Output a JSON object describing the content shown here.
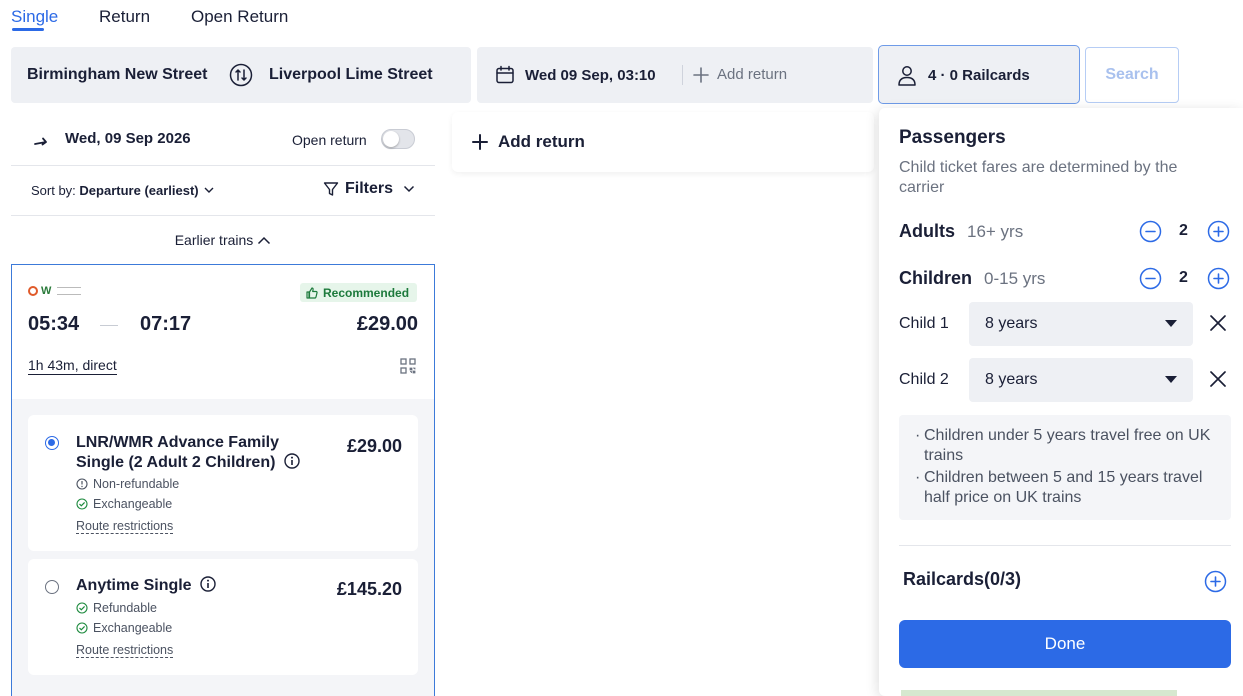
{
  "tabs": {
    "single": "Single",
    "return": "Return",
    "open_return": "Open Return"
  },
  "search": {
    "from": "Birmingham New Street",
    "to": "Liverpool Lime Street",
    "date": "Wed 09 Sep, 03:10",
    "add_return": "Add return",
    "passengers": "4 · 0 Railcards",
    "search_button": "Search"
  },
  "results": {
    "date": "Wed, 09 Sep 2026",
    "open_return_label": "Open return",
    "open_return_on": false,
    "sort_prefix": "Sort by:",
    "sort_value": "Departure (earliest)",
    "filters": "Filters",
    "earlier_trains": "Earlier trains",
    "journey": {
      "badge": "Recommended",
      "depart": "05:34",
      "arrive": "07:17",
      "price": "£29.00",
      "duration": "1h 43m, direct"
    },
    "fares": [
      {
        "name": "LNR/WMR Advance Family Single (2 Adult 2 Children)",
        "price": "£29.00",
        "selected": true,
        "line1": "Non-refundable",
        "line2": "Exchangeable",
        "restrictions": "Route restrictions"
      },
      {
        "name": "Anytime Single",
        "price": "£145.20",
        "selected": false,
        "line1": "Refundable",
        "line2": "Exchangeable",
        "restrictions": "Route restrictions"
      }
    ]
  },
  "middle": {
    "add_return": "Add return"
  },
  "passengers_panel": {
    "title": "Passengers",
    "subtitle": "Child ticket fares are determined by the carrier",
    "adults_label": "Adults",
    "adults_age": "16+ yrs",
    "adults_count": "2",
    "children_label": "Children",
    "children_age": "0-15 yrs",
    "children_count": "2",
    "child1_label": "Child 1",
    "child1_value": "8 years",
    "child2_label": "Child 2",
    "child2_value": "8 years",
    "note1": "Children under 5 years travel free on UK trains",
    "note2": "Children between 5 and 15 years travel half price on UK trains",
    "railcards": "Railcards(0/3)",
    "done": "Done"
  },
  "colors": {
    "accent": "#2c6ae6",
    "recommended_bg": "#e6f5ea",
    "recommended_text": "#1d7a3c"
  }
}
